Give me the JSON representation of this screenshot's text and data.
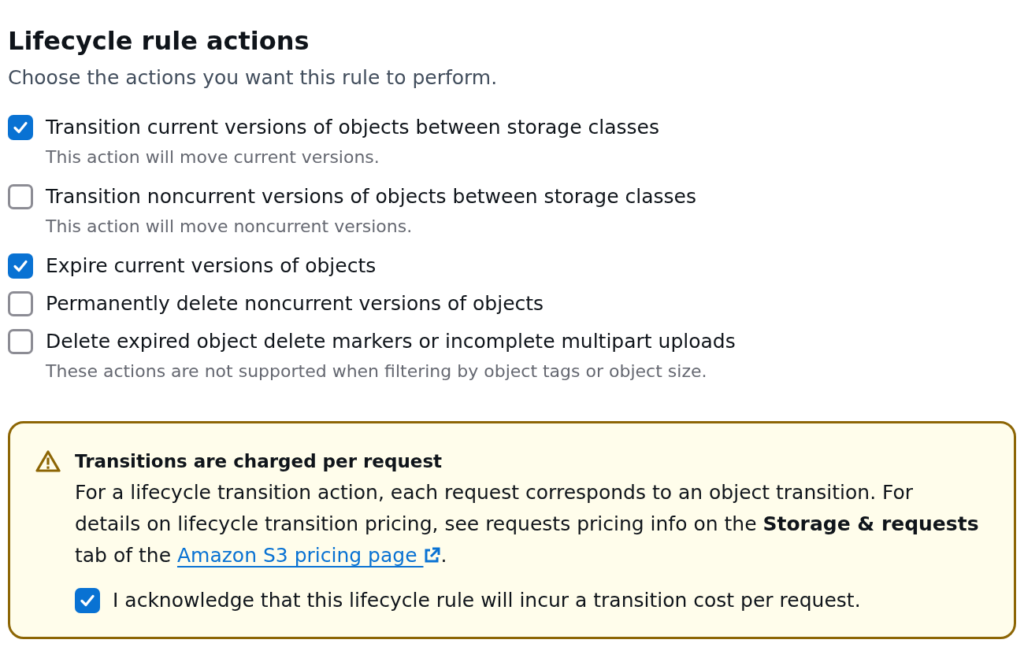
{
  "section": {
    "title": "Lifecycle rule actions",
    "description": "Choose the actions you want this rule to perform."
  },
  "actions": [
    {
      "label": "Transition current versions of objects between storage classes",
      "checked": true,
      "description": "This action will move current versions."
    },
    {
      "label": "Transition noncurrent versions of objects between storage classes",
      "checked": false,
      "description": "This action will move noncurrent versions."
    },
    {
      "label": "Expire current versions of objects",
      "checked": true
    },
    {
      "label": "Permanently delete noncurrent versions of objects",
      "checked": false
    },
    {
      "label": "Delete expired object delete markers or incomplete multipart uploads",
      "checked": false,
      "description": "These actions are not supported when filtering by object tags or object size."
    }
  ],
  "alert": {
    "kind": "warning",
    "title": "Transitions are charged per request",
    "body": "For a lifecycle transition action, each request corresponds to an object transition. For details on lifecycle transition pricing, see requests pricing info on the **Storage & requests** tab of the",
    "link": {
      "text": "Amazon S3 pricing page",
      "external": true
    },
    "after_link": ".",
    "acknowledge": {
      "label": "I acknowledge that this lifecycle rule will incur a transition cost per request.",
      "checked": true
    }
  }
}
